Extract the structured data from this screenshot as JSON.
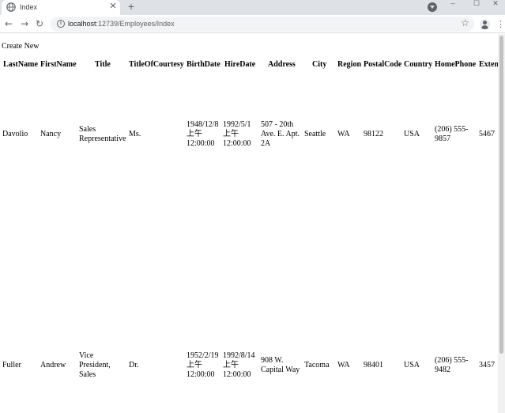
{
  "browser": {
    "tab_title": "Index",
    "url_host": "localhost",
    "url_path": ":12739/Employees/Index"
  },
  "page": {
    "create_new": "Create New",
    "columns": [
      "LastName",
      "FirstName",
      "Title",
      "TitleOfCourtesy",
      "BirthDate",
      "HireDate",
      "Address",
      "City",
      "Region",
      "PostalCode",
      "Country",
      "HomePhone",
      "Extensi"
    ],
    "rows": [
      {
        "last_name": "Davolio",
        "first_name": "Nancy",
        "title": [
          "Sales",
          "Representative"
        ],
        "courtesy": "Ms.",
        "birth_date": [
          "1948/12/8",
          "上午",
          "12:00:00"
        ],
        "hire_date": [
          "1992/5/1",
          "上午",
          "12:00:00"
        ],
        "address": [
          "507 - 20th",
          "Ave. E. Apt.",
          "2A"
        ],
        "city": "Seattle",
        "region": "WA",
        "postal_code": "98122",
        "country": "USA",
        "home_phone": [
          "(206) 555-",
          "9857"
        ],
        "extension": "5467"
      },
      {
        "last_name": "Fuller",
        "first_name": "Andrew",
        "title": [
          "Vice",
          "President,",
          "Sales"
        ],
        "courtesy": "Dr.",
        "birth_date": [
          "1952/2/19",
          "上午",
          "12:00:00"
        ],
        "hire_date": [
          "1992/8/14",
          "上午",
          "12:00:00"
        ],
        "address": [
          "908 W.",
          "Capital Way"
        ],
        "city": "Tacoma",
        "region": "WA",
        "postal_code": "98401",
        "country": "USA",
        "home_phone": [
          "(206) 555-",
          "9482"
        ],
        "extension": "3457"
      }
    ]
  }
}
